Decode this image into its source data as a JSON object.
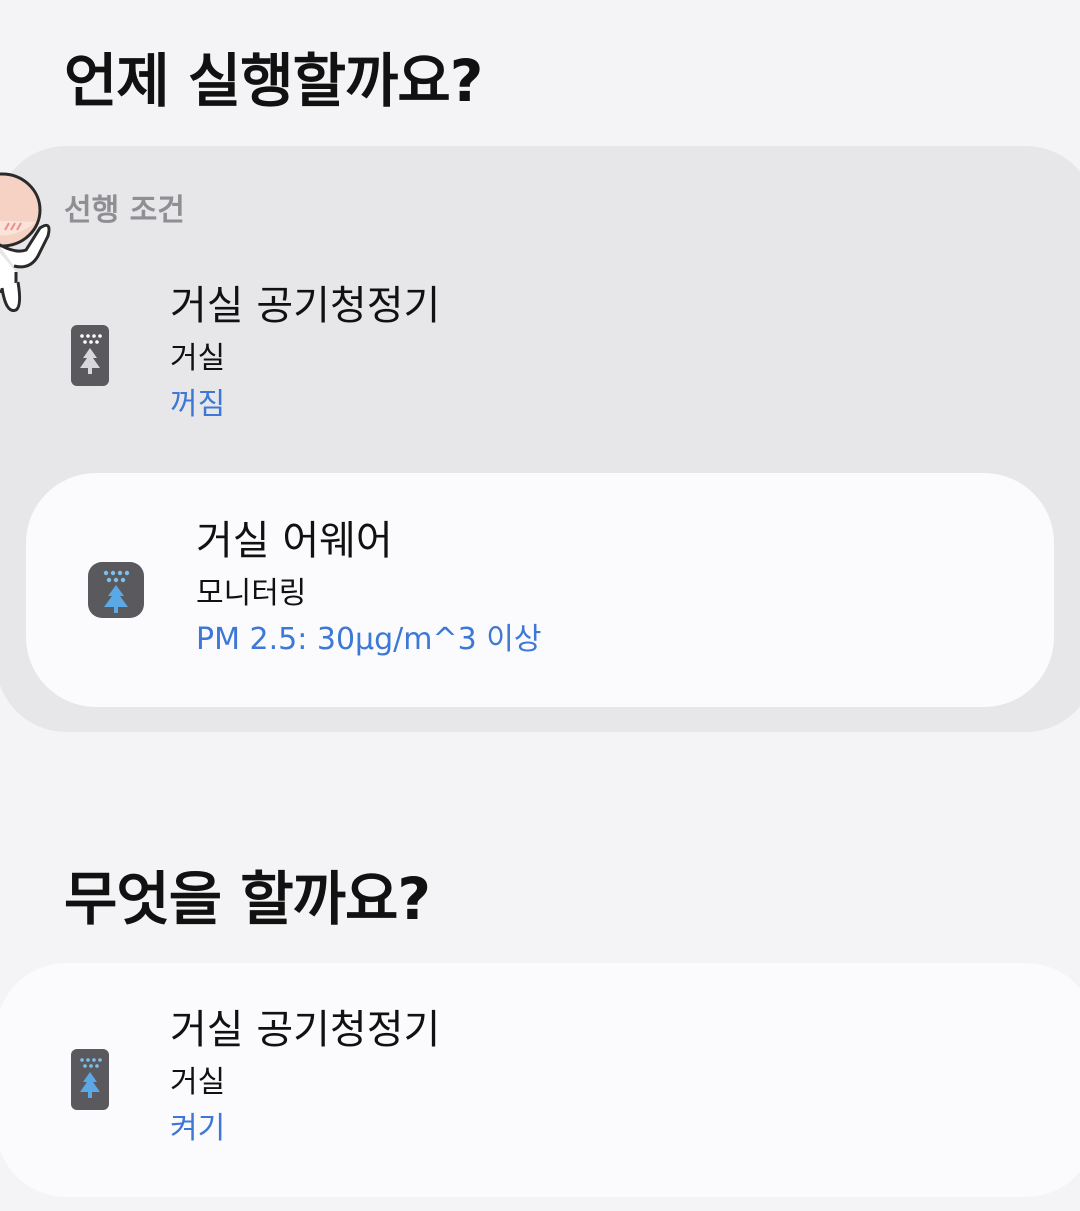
{
  "when_section": {
    "title": "언제 실행할까요?",
    "precondition_label": "선행 조건",
    "precondition_device": {
      "name": "거실 공기청정기",
      "room": "거실",
      "state": "꺼짐",
      "icon": "air-purifier-icon"
    },
    "trigger_device": {
      "name": "거실 어웨어",
      "room": "모니터링",
      "state": "PM 2.5: 30µg/m^3 이상",
      "icon": "air-monitor-icon"
    }
  },
  "what_section": {
    "title": "무엇을 할까요?",
    "action_device": {
      "name": "거실 공기청정기",
      "room": "거실",
      "state": "켜기",
      "icon": "air-purifier-icon"
    }
  },
  "colors": {
    "background": "#f4f4f6",
    "group_background": "#e7e7e9",
    "card_background": "#fbfbfd",
    "state_text": "#3e78d6",
    "icon_dark": "#5a5a5e",
    "icon_accent": "#5aa8e6"
  }
}
